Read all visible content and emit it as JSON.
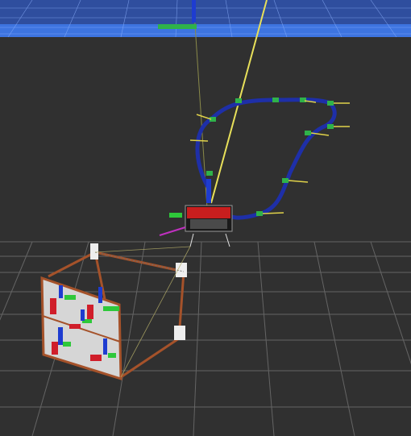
{
  "viewport": {
    "kind": "3d-robot-visualization",
    "background_color": "#303030",
    "grid_color": "#6e6e6e",
    "water_surface_color": "#3a6fd8",
    "water_grid_color": "#8fb3ff"
  },
  "objects": {
    "trajectory_color": "#1e2fa8",
    "waypoint_marker_color": "#2fb24a",
    "heading_arrow_color": "#e0d24a",
    "tether_color": "#e8e05a",
    "robot_color": "#c81e1e",
    "panel_frame_color": "#a5522a",
    "panel_color": "#d6d6d6",
    "axis_x_color": "#d01e2a",
    "axis_y_color": "#2ec83a",
    "axis_z_color": "#1e3cd0"
  },
  "icons": {
    "robot": "underwater-vehicle-icon",
    "panel": "intervention-panel-icon",
    "valves": "valve-frame-icon"
  }
}
